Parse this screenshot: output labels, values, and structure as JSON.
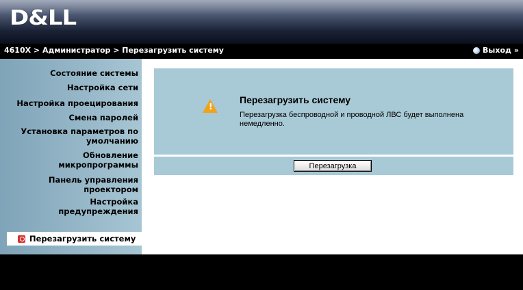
{
  "header": {
    "logo_text": "D&LL"
  },
  "breadcrumb": {
    "text": "4610X > Администратор > Перезагрузить систему"
  },
  "logout": {
    "label": "Выход",
    "arrow": "»"
  },
  "sidebar": {
    "items": [
      {
        "label": "Состояние системы"
      },
      {
        "label": "Настройка сети"
      },
      {
        "label": "Настройка проецирования"
      },
      {
        "label": "Смена паролей"
      },
      {
        "label": "Установка параметров по умолчанию"
      },
      {
        "label": "Обновление микропрограммы"
      },
      {
        "label": "Панель управления проектором"
      },
      {
        "label": "Настройка предупреждения"
      }
    ],
    "active": {
      "label": "Перезагрузить систему",
      "icon": "power-icon"
    }
  },
  "content": {
    "title": "Перезагрузить систему",
    "description": "Перезагрузка беспроводной и проводной ЛВС будет выполнена немедленно.",
    "warning_icon": "warning-icon",
    "button_label": "Перезагрузка"
  },
  "colors": {
    "panel": "#a8c9d6",
    "sidebar": "#a7c6d4",
    "warning": "#f0a21a",
    "bar": "#000000"
  }
}
